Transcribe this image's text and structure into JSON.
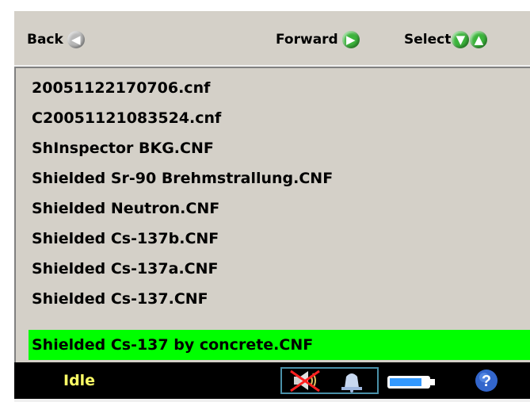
{
  "toolbar": {
    "back_label": "Back",
    "forward_label": "Forward",
    "select_label": "Select"
  },
  "files": [
    {
      "name": "20051122170706.cnf",
      "selected": false
    },
    {
      "name": "C20051121083524.cnf",
      "selected": false
    },
    {
      "name": "ShInspector BKG.CNF",
      "selected": false
    },
    {
      "name": "Shielded Sr-90 Brehmstrallung.CNF",
      "selected": false
    },
    {
      "name": "Shielded Neutron.CNF",
      "selected": false
    },
    {
      "name": "Shielded Cs-137b.CNF",
      "selected": false
    },
    {
      "name": "Shielded Cs-137a.CNF",
      "selected": false
    },
    {
      "name": "Shielded Cs-137.CNF",
      "selected": false
    },
    {
      "name": "Shielded Cs-137 by concrete.CNF",
      "selected": true
    }
  ],
  "status": {
    "state": "Idle",
    "icons": [
      "speaker-muted-icon",
      "bell-icon",
      "battery-icon",
      "help-icon"
    ]
  },
  "colors": {
    "selection": "#00ff00",
    "status_text": "#ffff66",
    "battery_level": "#3399ff",
    "help": "#3366cc"
  }
}
